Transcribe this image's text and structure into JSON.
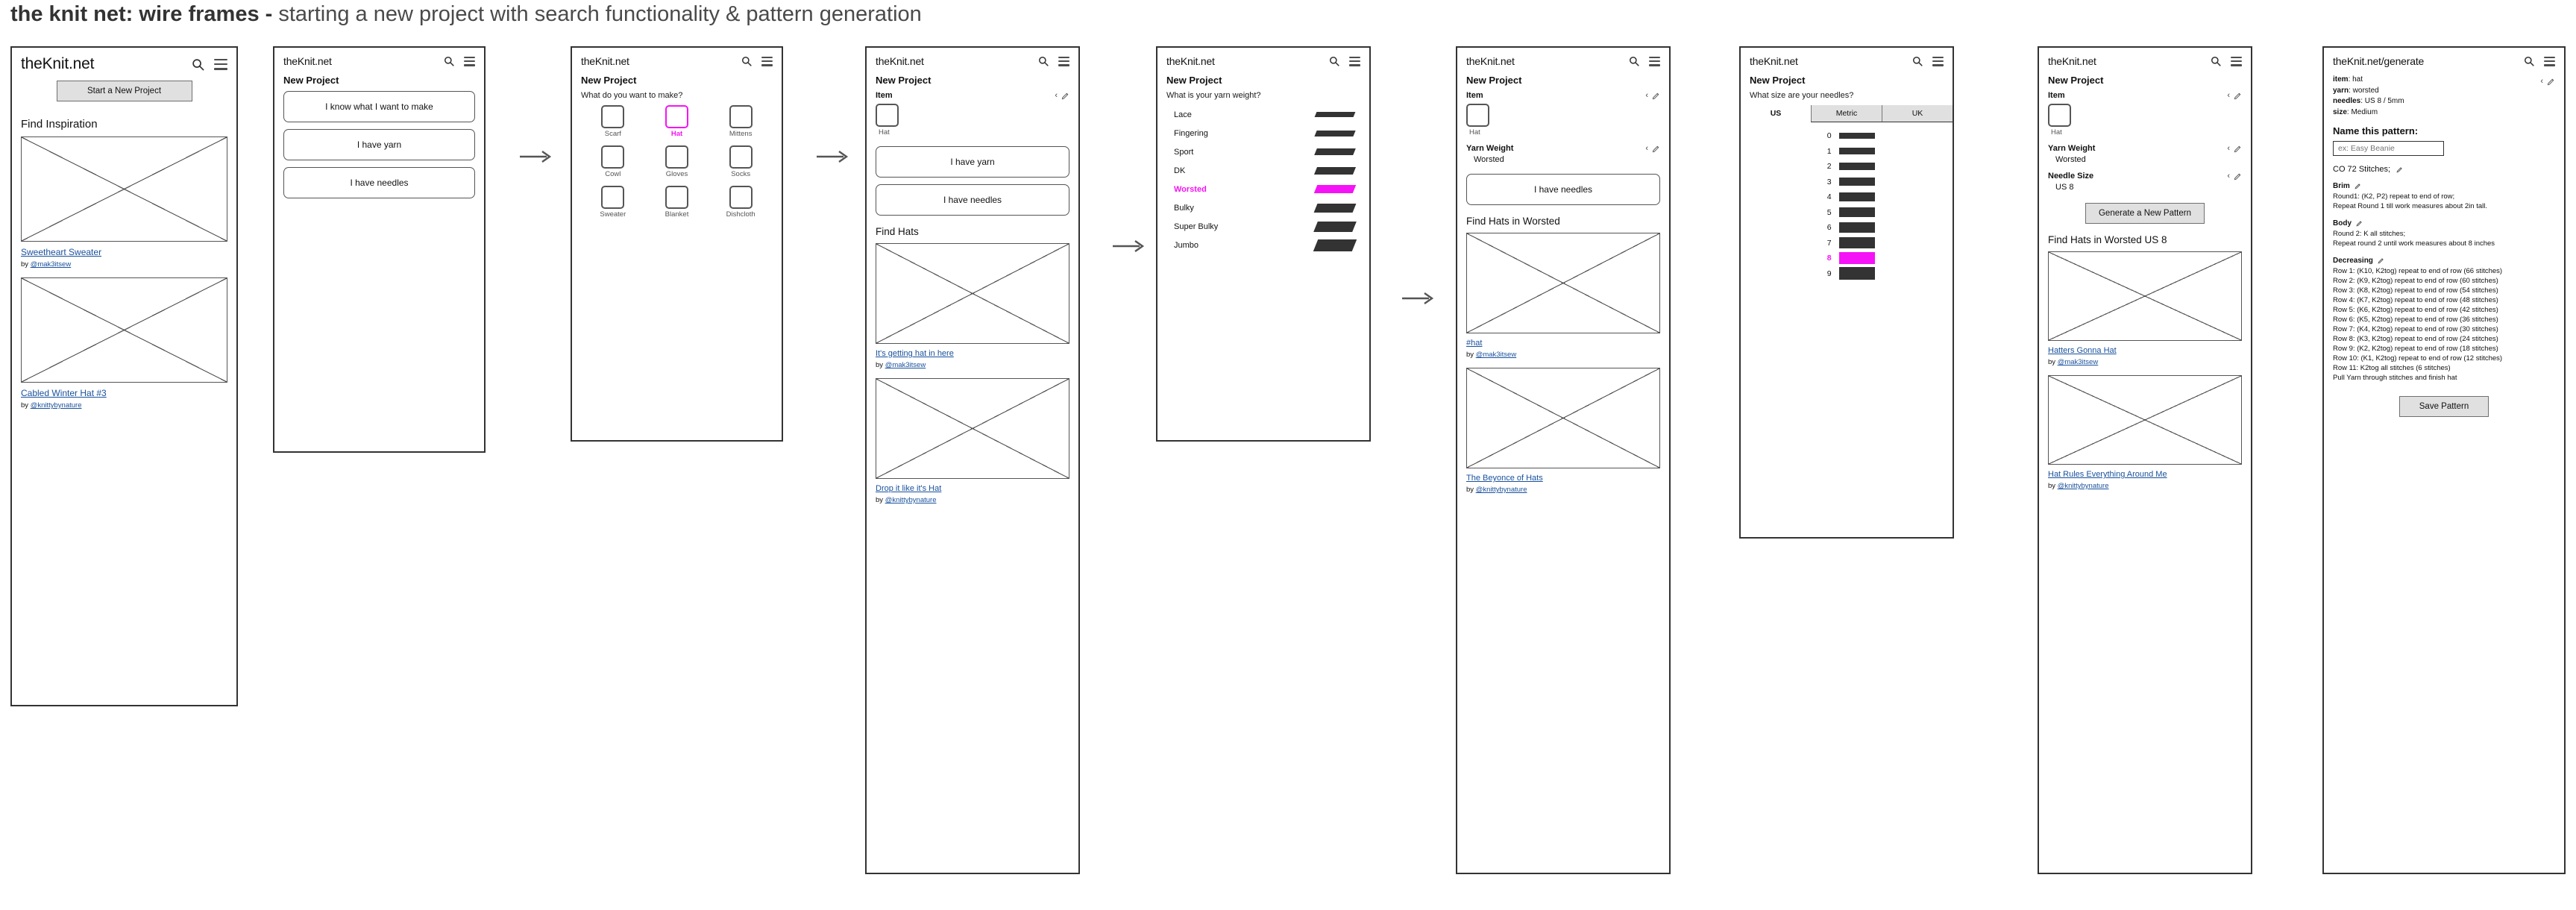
{
  "title": {
    "strong": "the knit net: wire frames",
    "dash": " - ",
    "rest": "starting a new project with search functionality & pattern generation"
  },
  "brand": "theKnit.net",
  "brand_generate": "theKnit.net/generate",
  "icons": {
    "search": "search-icon",
    "menu": "hamburger-menu-icon",
    "pencil": "edit-pencil-icon",
    "chevron": "‹"
  },
  "colors": {
    "accent": "#f612f6",
    "link": "#19519c",
    "swatch": "#333333",
    "button_fill": "#e0e0e0"
  },
  "frame1": {
    "start_button": "Start a New Project",
    "section_heading": "Find Inspiration",
    "cards": [
      {
        "title": "Sweetheart Sweater",
        "by_prefix": "by ",
        "author": "@mak3itsew"
      },
      {
        "title": "Cabled Winter Hat #3",
        "by_prefix": "by ",
        "author": "@knittybynature"
      }
    ]
  },
  "frame2": {
    "heading": "New Project",
    "options": [
      "I know what I want to make",
      "I have yarn",
      "I have needles"
    ]
  },
  "frame3": {
    "heading": "New Project",
    "question": "What do you want to make?",
    "items": [
      {
        "label": "Scarf",
        "selected": false
      },
      {
        "label": "Hat",
        "selected": true
      },
      {
        "label": "Mittens",
        "selected": false
      },
      {
        "label": "Cowl",
        "selected": false
      },
      {
        "label": "Gloves",
        "selected": false
      },
      {
        "label": "Socks",
        "selected": false
      },
      {
        "label": "Sweater",
        "selected": false
      },
      {
        "label": "Blanket",
        "selected": false
      },
      {
        "label": "Dishcloth",
        "selected": false
      }
    ]
  },
  "frame4": {
    "heading": "New Project",
    "item_label": "Item",
    "item_value": "Hat",
    "options": [
      "I have yarn",
      "I have needles"
    ],
    "section_heading": "Find Hats",
    "cards": [
      {
        "title": "It's getting hat in here",
        "by_prefix": "by ",
        "author": "@mak3itsew"
      },
      {
        "title": "Drop it like it's Hat",
        "by_prefix": "by ",
        "author": "@knittybynature"
      }
    ]
  },
  "frame5": {
    "heading": "New Project",
    "question": "What is your yarn weight?",
    "weights": [
      {
        "label": "Lace",
        "selected": false,
        "thickness": 7
      },
      {
        "label": "Fingering",
        "selected": false,
        "thickness": 8
      },
      {
        "label": "Sport",
        "selected": false,
        "thickness": 9
      },
      {
        "label": "DK",
        "selected": false,
        "thickness": 10
      },
      {
        "label": "Worsted",
        "selected": true,
        "thickness": 11
      },
      {
        "label": "Bulky",
        "selected": false,
        "thickness": 12
      },
      {
        "label": "Super Bulky",
        "selected": false,
        "thickness": 14
      },
      {
        "label": "Jumbo",
        "selected": false,
        "thickness": 16
      }
    ]
  },
  "frame6": {
    "heading": "New Project",
    "item_label": "Item",
    "item_value": "Hat",
    "yarn_label": "Yarn Weight",
    "yarn_value": "Worsted",
    "option": "I have needles",
    "section_heading": "Find Hats in Worsted",
    "cards": [
      {
        "title": "#hat",
        "by_prefix": "by ",
        "author": "@mak3itsew"
      },
      {
        "title": "The Beyonce of Hats",
        "by_prefix": "by ",
        "author": "@knittybynature"
      }
    ]
  },
  "frame7": {
    "heading": "New Project",
    "question": "What size are your needles?",
    "tabs": [
      {
        "label": "US",
        "active": true
      },
      {
        "label": "Metric",
        "active": false
      },
      {
        "label": "UK",
        "active": false
      }
    ],
    "sizes": [
      {
        "label": "0",
        "selected": false,
        "thickness": 8
      },
      {
        "label": "1",
        "selected": false,
        "thickness": 9
      },
      {
        "label": "2",
        "selected": false,
        "thickness": 10
      },
      {
        "label": "3",
        "selected": false,
        "thickness": 11
      },
      {
        "label": "4",
        "selected": false,
        "thickness": 12
      },
      {
        "label": "5",
        "selected": false,
        "thickness": 13
      },
      {
        "label": "6",
        "selected": false,
        "thickness": 14
      },
      {
        "label": "7",
        "selected": false,
        "thickness": 15
      },
      {
        "label": "8",
        "selected": true,
        "thickness": 16
      },
      {
        "label": "9",
        "selected": false,
        "thickness": 17
      }
    ]
  },
  "frame8": {
    "heading": "New Project",
    "item_label": "Item",
    "item_value": "Hat",
    "yarn_label": "Yarn Weight",
    "yarn_value": "Worsted",
    "needle_label": "Needle Size",
    "needle_value": "US 8",
    "generate_button": "Generate a New Pattern",
    "section_heading": "Find Hats in Worsted US 8",
    "cards": [
      {
        "title": "Hatters Gonna Hat",
        "by_prefix": "by ",
        "author": "@mak3itsew"
      },
      {
        "title": "Hat Rules Everything Around Me",
        "by_prefix": "by ",
        "author": "@knittybynature"
      }
    ]
  },
  "frame9": {
    "meta": [
      {
        "key": "item",
        "value": "hat"
      },
      {
        "key": "yarn",
        "value": "worsted"
      },
      {
        "key": "needles",
        "value": "US 8 / 5mm"
      },
      {
        "key": "size",
        "value": "Medium"
      }
    ],
    "name_heading": "Name this pattern:",
    "name_placeholder": "ex: Easy Beanie",
    "cast_on": "CO 72 Stitches;",
    "sections": [
      {
        "heading": "Brim",
        "lines": [
          "Round1: (K2, P2) repeat to end of row;",
          "Repeat Round 1 till work measures about 2in tall."
        ]
      },
      {
        "heading": "Body",
        "lines": [
          "Round 2: K all stitches;",
          "Repeat round 2 until work measures about 8 inches"
        ]
      },
      {
        "heading": "Decreasing",
        "lines": [
          "Row 1: (K10, K2tog) repeat to end of row (66 stitches)",
          "Row 2: (K9, K2tog) repeat to end of row (60 stitches)",
          "Row 3: (K8, K2tog) repeat to end of row (54 stitches)",
          "Row 4: (K7, K2tog) repeat to end of row (48 stitches)",
          "Row 5: (K6, K2tog) repeat to end of row (42 stitches)",
          "Row 6: (K5, K2tog) repeat to end of row (36 stitches)",
          "Row 7: (K4, K2tog) repeat to end of row (30 stitches)",
          "Row 8: (K3, K2tog) repeat to end of row (24 stitches)",
          "Row 9: (K2, K2tog) repeat to end of row (18 stitches)",
          "Row 10: (K1, K2tog) repeat to end of row (12 stitches)",
          "Row 11: K2tog all stitches (6 stitches)",
          "Pull Yarn through stitches and finish hat"
        ]
      }
    ],
    "save_button": "Save Pattern"
  }
}
